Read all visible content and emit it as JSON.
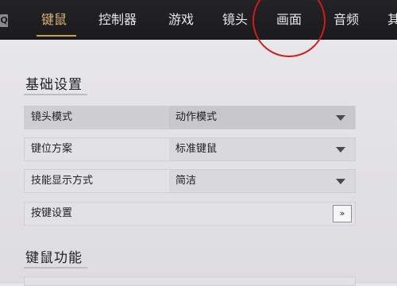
{
  "nav": {
    "search_glyph": "Q",
    "tabs": [
      {
        "label": "键鼠",
        "active": true
      },
      {
        "label": "控制器",
        "active": false
      },
      {
        "label": "游戏",
        "active": false
      },
      {
        "label": "镜头",
        "active": false
      },
      {
        "label": "画面",
        "active": false
      },
      {
        "label": "音频",
        "active": false
      },
      {
        "label": "其",
        "active": false
      }
    ]
  },
  "sections": {
    "basic": {
      "title": "基础设置",
      "rows": [
        {
          "label": "镜头模式",
          "value": "动作模式"
        },
        {
          "label": "键位方案",
          "value": "标准键鼠"
        },
        {
          "label": "技能显示方式",
          "value": "简洁"
        },
        {
          "label": "按键设置",
          "button": "»"
        }
      ]
    },
    "mouse": {
      "title": "键鼠功能"
    }
  },
  "colors": {
    "active_tab": "#d7b477",
    "annotation_circle": "#d21a1a"
  }
}
